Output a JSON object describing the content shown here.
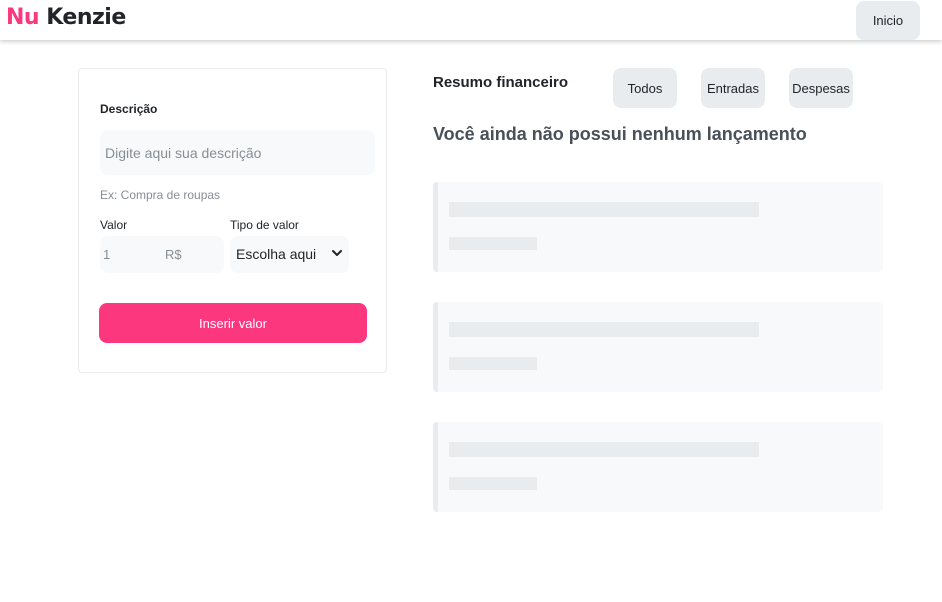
{
  "header": {
    "logo_nu": "Nu",
    "logo_kenzie": "Kenzie",
    "inicio_label": "Inicio"
  },
  "form": {
    "description_label": "Descrição",
    "description_placeholder": "Digite aqui sua descrição",
    "hint": "Ex: Compra de roupas",
    "valor_label": "Valor",
    "valor_value": "1",
    "valor_currency": "R$",
    "tipo_label": "Tipo de valor",
    "tipo_selected": "Escolha aqui",
    "submit_label": "Inserir valor"
  },
  "summary": {
    "title": "Resumo financeiro",
    "filters": [
      "Todos",
      "Entradas",
      "Despesas"
    ],
    "empty_message": "Você ainda não possui nenhum lançamento"
  },
  "colors": {
    "brand": "#fd377e",
    "grey_light": "#f8f9fa",
    "grey_button": "#e9ecef",
    "text_dark": "#212529",
    "text_muted": "#868e96"
  }
}
